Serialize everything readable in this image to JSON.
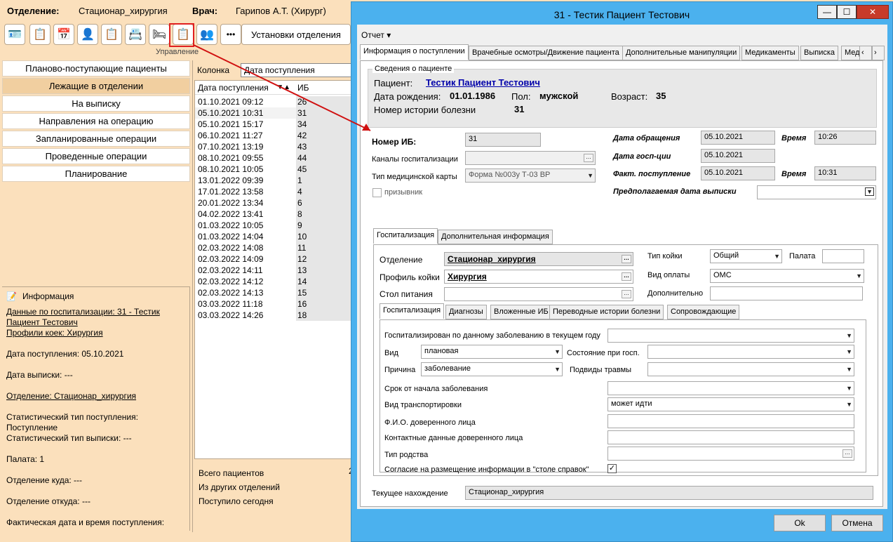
{
  "header": {
    "dept_label": "Отделение:",
    "dept_value": "Стационар_хирургия",
    "doctor_label": "Врач:",
    "doctor_value": "Гарипов А.Т. (Хирург)"
  },
  "toolbar": {
    "settings_label": "Установки отделения",
    "group_label": "Управление",
    "more_label": "•••"
  },
  "nav": {
    "items": [
      {
        "label": "Планово-поступающие пациенты",
        "selected": false
      },
      {
        "label": "Лежащие в отделении",
        "selected": true
      },
      {
        "label": "На выписку",
        "selected": false
      },
      {
        "label": "Направления на операцию",
        "selected": false
      },
      {
        "label": "Запланированные операции",
        "selected": false
      },
      {
        "label": "Проведенные операции",
        "selected": false
      },
      {
        "label": "Планирование",
        "selected": false
      }
    ]
  },
  "info": {
    "title": "Информация",
    "lines": [
      "Данные по госпитализации: 31 - Тестик",
      "Пациент Тестович",
      "Профили коек: Хирургия",
      "Дата поступления: 05.10.2021",
      "Дата выписки: ---",
      "Отделение: Стационар_хирургия",
      "Статистический тип поступления:",
      "Поступление",
      "Статистический тип выписки: ---",
      "Палата: 1",
      "Отделение куда: ---",
      "Отделение откуда: ---",
      "Фактическая дата и время поступления:"
    ]
  },
  "grid": {
    "column_label": "Колонка",
    "column_value": "Дата поступления",
    "headers": [
      "Дата поступления",
      "ИБ"
    ],
    "rows": [
      [
        "01.10.2021 09:12",
        "26"
      ],
      [
        "05.10.2021 10:31",
        "31"
      ],
      [
        "05.10.2021 15:17",
        "34"
      ],
      [
        "06.10.2021 11:27",
        "42"
      ],
      [
        "07.10.2021 13:19",
        "43"
      ],
      [
        "08.10.2021 09:55",
        "44"
      ],
      [
        "08.10.2021 10:05",
        "45"
      ],
      [
        "13.01.2022 09:39",
        "1"
      ],
      [
        "17.01.2022 13:58",
        "4"
      ],
      [
        "20.01.2022 13:34",
        "6"
      ],
      [
        "04.02.2022 13:41",
        "8"
      ],
      [
        "01.03.2022 10:05",
        "9"
      ],
      [
        "01.03.2022 14:04",
        "10"
      ],
      [
        "02.03.2022 14:08",
        "11"
      ],
      [
        "02.03.2022 14:09",
        "12"
      ],
      [
        "02.03.2022 14:11",
        "13"
      ],
      [
        "02.03.2022 14:12",
        "14"
      ],
      [
        "02.03.2022 14:13",
        "15"
      ],
      [
        "03.03.2022 11:18",
        "16"
      ],
      [
        "03.03.2022 14:26",
        "18"
      ]
    ],
    "stats": {
      "total": "Всего пациентов",
      "from_other": "Из других отделений",
      "today": "Поступило сегодня",
      "total_value": "2"
    }
  },
  "dialog": {
    "title": "31 - Тестик Пациент Тестович",
    "menu": "Отчет ▾",
    "tabs": [
      "Информация о поступлении",
      "Врачебные осмотры/Движение пациента",
      "Дополнительные манипуляции",
      "Медикаменты",
      "Выписка",
      "Мед"
    ],
    "patient": {
      "legend": "Сведения о пациенте",
      "name_label": "Пациент:",
      "name": "Тестик Пациент Тестович",
      "dob_label": "Дата рождения:",
      "dob": "01.01.1986",
      "sex_label": "Пол:",
      "sex": "мужской",
      "age_label": "Возраст:",
      "age": "35",
      "hist_label": "Номер истории болезни",
      "hist": "31"
    },
    "fields": {
      "ib_label": "Номер ИБ:",
      "ib": "31",
      "channels_label": "Каналы госпитализации",
      "channels": "",
      "card_label": "Тип медицинской карты",
      "card": "Форма №003у Т-03 ВР",
      "conscript_label": "призывник",
      "appeal_label": "Дата обращения",
      "appeal": "05.10.2021",
      "time_label": "Время",
      "appeal_time": "10:26",
      "hosp_date_label": "Дата госп-ции",
      "hosp_date": "05.10.2021",
      "fact_label": "Факт. поступление",
      "fact": "05.10.2021",
      "fact_time": "10:31",
      "discharge_label": "Предполагаемая дата выписки",
      "discharge": ""
    },
    "subtabs": [
      "Госпитализация",
      "Дополнительная информация"
    ],
    "hosp": {
      "dept_label": "Отделение",
      "dept": "Стационар_хирургия",
      "profile_label": "Профиль койки",
      "profile": "Хирургия",
      "diet_label": "Стол питания",
      "diet": "",
      "bedtype_label": "Тип койки",
      "bedtype": "Общий",
      "ward_label": "Палата",
      "ward": "",
      "pay_label": "Вид оплаты",
      "pay": "ОМС",
      "extra_label": "Дополнительно",
      "extra": ""
    },
    "subtabs2": [
      "Госпитализация",
      "Диагнозы",
      "Вложенные ИБ",
      "Переводные истории болезни",
      "Сопровождающие"
    ],
    "hosp2": {
      "q1_label": "Госпитализирован по данному заболеванию в текущем году",
      "q1": "",
      "kind_label": "Вид",
      "kind": "плановая",
      "state_label": "Состояние при госп.",
      "state": "",
      "reason_label": "Причина",
      "reason": "заболевание",
      "trauma_label": "Подвиды травмы",
      "trauma": "",
      "term_label": "Срок от начала заболевания",
      "term": "",
      "transport_label": "Вид транспортировки",
      "transport": "может идти",
      "trustee_label": "Ф.И.О. доверенного лица",
      "trustee": "",
      "contacts_label": "Контактные данные доверенного лица",
      "contacts": "",
      "relation_label": "Тип родства",
      "relation": "",
      "consent_label": "Согласие на размещение информации в \"столе справок\"",
      "consent": "✓"
    },
    "current_label": "Текущее нахождение",
    "current": "Стационар_хирургия",
    "ok": "Ok",
    "cancel": "Отмена"
  },
  "colors": {
    "bg": "#fbe0bc",
    "dialog_frame": "#4bb1ee",
    "link": "#0000aa",
    "arrow": "#d01010"
  }
}
